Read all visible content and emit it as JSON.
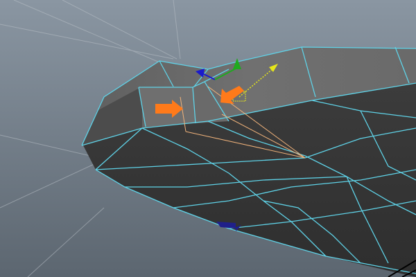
{
  "viewport": {
    "background_top": "#8a96a2",
    "background_bottom": "#5c6670",
    "grid_color": "#b9c0c7",
    "mesh_top_color": "#6a6a6a",
    "mesh_side_color": "#3f3f3f",
    "wireframe_color": "#5fd3e8",
    "edge_loop_color": "#f0b27a",
    "annotation_arrow_color": "#ff7a1a"
  },
  "manipulator": {
    "x_axis_color": "#1a1acc",
    "y_axis_color": "#1faa1f",
    "z_axis_color": "#e6e61a",
    "center_box_color": "#e6e61a"
  }
}
